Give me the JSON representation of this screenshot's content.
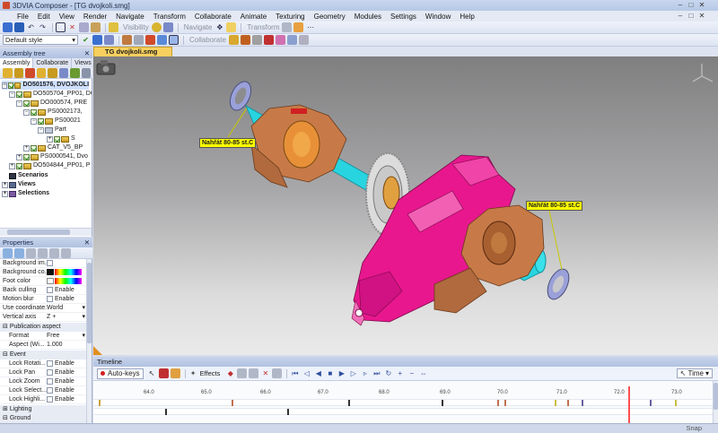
{
  "window": {
    "title": "3DVIA Composer - [TG dvojkoli.smg]",
    "controls": [
      "–",
      "□",
      "✕"
    ],
    "doc_controls": [
      "–",
      "□",
      "✕"
    ]
  },
  "menu": [
    "File",
    "Edit",
    "View",
    "Render",
    "Navigate",
    "Transform",
    "Collaborate",
    "Animate",
    "Texturing",
    "Geometry",
    "Modules",
    "Settings",
    "Window",
    "Help"
  ],
  "toolbar": {
    "visibility_label": "Visibility",
    "navigate_label": "Navigate",
    "transform_label": "Transform",
    "collaborate_label": "Collaborate",
    "style_combo": "Default style"
  },
  "assembly_tree": {
    "title": "Assembly tree",
    "tabs": [
      "Assembly ...",
      "Collaborate",
      "Views"
    ],
    "nodes": [
      {
        "label": "DO501576, DVOJKOLI",
        "level": 0,
        "selected": true
      },
      {
        "label": "DO505704_PP01, DO",
        "level": 1
      },
      {
        "label": "DO000574, PRE",
        "level": 2
      },
      {
        "label": "PS0002173,",
        "level": 3
      },
      {
        "label": "PS00021",
        "level": 4
      },
      {
        "label": "Part",
        "level": 5
      },
      {
        "label": "S",
        "level": 6
      },
      {
        "label": "CAT_V5_BP",
        "level": 3
      },
      {
        "label": "PS0000541, Dvo",
        "level": 2
      },
      {
        "label": "DO504844_PP01, P",
        "level": 1
      }
    ],
    "sections": [
      "Scenarios",
      "Views",
      "Selections"
    ]
  },
  "properties": {
    "title": "Properties",
    "rows": [
      {
        "label": "Background im...",
        "value": ""
      },
      {
        "label": "Background co...",
        "value": ""
      },
      {
        "label": "Foot color",
        "value": ""
      },
      {
        "label": "Back culling",
        "value": "Enable"
      },
      {
        "label": "Motion blur",
        "value": "Enable"
      },
      {
        "label": "Use coordinate...",
        "value": "World"
      },
      {
        "label": "Vertical axis",
        "value": "Z +"
      }
    ],
    "group_publication": "Publication aspect",
    "publication_rows": [
      {
        "label": "Format",
        "value": "Free"
      },
      {
        "label": "Aspect (Wi...",
        "value": "1.000"
      }
    ],
    "group_event": "Event",
    "event_rows": [
      {
        "label": "Lock Rotati...",
        "value": "Enable"
      },
      {
        "label": "Lock Pan",
        "value": "Enable"
      },
      {
        "label": "Lock Zoom",
        "value": "Enable"
      },
      {
        "label": "Lock Select...",
        "value": "Enable"
      },
      {
        "label": "Lock Highli...",
        "value": "Enable"
      }
    ],
    "group_lighting": "Lighting",
    "group_ground": "Ground"
  },
  "viewport": {
    "tab_label": "TG dvojkoli.smg",
    "callout_left": "Nahřát  80-85 st.C",
    "callout_right": "Nahřát  80-85 st.C"
  },
  "timeline": {
    "title": "Timeline",
    "autokeys": "Auto-keys",
    "effects": "Effects",
    "time_label": "Time",
    "ticks": [
      "64.0",
      "65.0",
      "66.0",
      "67.0",
      "68.0",
      "69.0",
      "70.0",
      "71.0",
      "72.0",
      "73.0"
    ]
  },
  "status": {
    "snap": "Snap"
  },
  "colors": {
    "callout": "#ffff00",
    "housing": "#e8178e",
    "shaft": "#28d4e0",
    "bearing": "#c77a48",
    "doctab": "#f6cf5e"
  }
}
